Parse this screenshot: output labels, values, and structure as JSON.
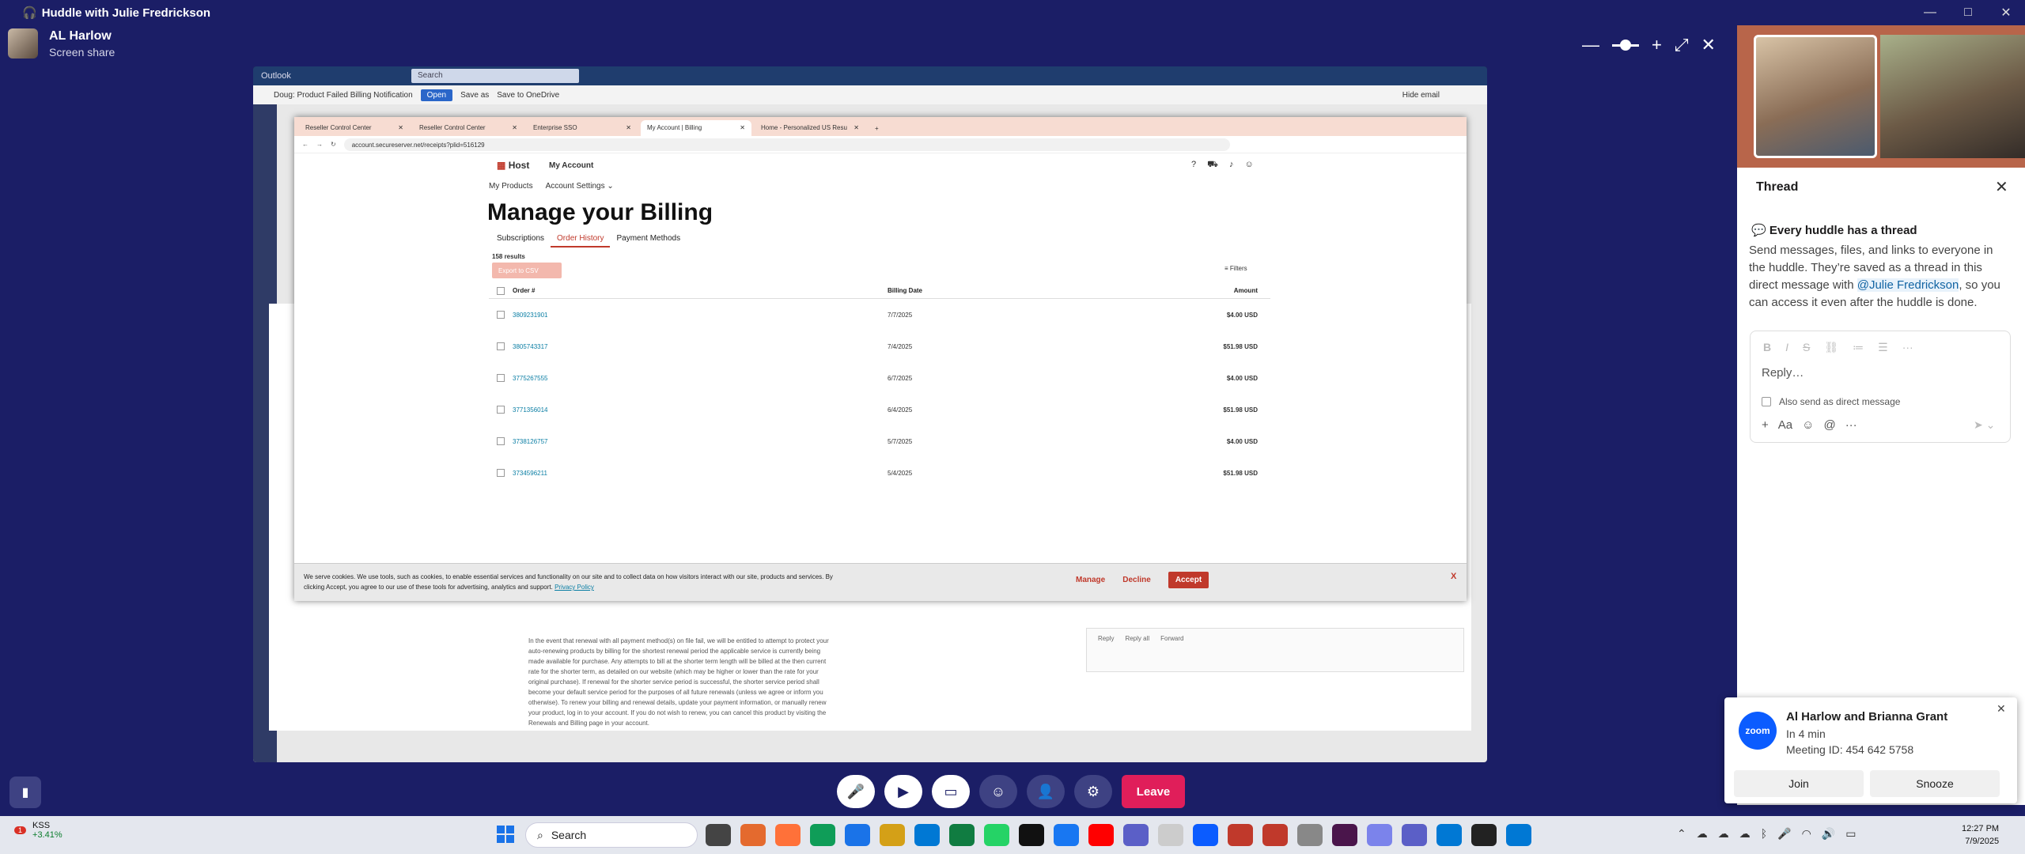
{
  "window": {
    "title": "Huddle with Julie Fredrickson",
    "controls": [
      "—",
      "□",
      "✕"
    ]
  },
  "presenter": {
    "name": "AL Harlow",
    "status": "Screen share"
  },
  "zoom_controls": {
    "minus": "—",
    "plus": "+",
    "fit": "⤢",
    "close": "✕"
  },
  "outlook": {
    "app": "Outlook",
    "search": "Search",
    "subject": "Doug: Product Failed Billing Notification",
    "open": "Open",
    "save_as": "Save as",
    "save_onedrive": "Save to OneDrive",
    "hide_email": "Hide email",
    "mail_text": "In the event that renewal with all payment method(s) on file fail, we will be entitled to attempt to protect your auto-renewing products by billing for the shortest renewal period the applicable service is currently being made available for purchase. Any attempts to bill at the shorter term length will be billed at the then current rate for the shorter term, as detailed on our website (which may be higher or lower than the rate for your original purchase). If renewal for the shorter service period is successful, the shorter service period shall become your default service period for the purposes of all future renewals (unless we agree or inform you otherwise). To renew your billing and renewal details, update your payment information, or manually renew your product, log in to your account. If you do not wish to renew, you can cancel this product by visiting the Renewals and Billing page in your account.",
    "reply_actions": [
      "Reply",
      "Reply all",
      "Forward"
    ]
  },
  "browser": {
    "tabs": [
      {
        "label": "Reseller Control Center"
      },
      {
        "label": "Reseller Control Center"
      },
      {
        "label": "Enterprise SSO"
      },
      {
        "label": "My Account | Billing"
      },
      {
        "label": "Home - Personalized US Resu"
      }
    ],
    "url": "account.secureserver.net/receipts?plid=516129"
  },
  "site": {
    "logo": "Host",
    "my_account": "My Account",
    "nav": [
      "My Products",
      "Account Settings ⌄"
    ],
    "heading": "Manage your Billing",
    "tabs": [
      "Subscriptions",
      "Order History",
      "Payment Methods"
    ],
    "results": "158 results",
    "export": "Export to CSV",
    "filters": "Filters",
    "columns": [
      "Order #",
      "Billing Date",
      "Amount"
    ],
    "rows": [
      {
        "order": "3809231901",
        "date": "7/7/2025",
        "amount": "$4.00 USD"
      },
      {
        "order": "3805743317",
        "date": "7/4/2025",
        "amount": "$51.98 USD"
      },
      {
        "order": "3775267555",
        "date": "6/7/2025",
        "amount": "$4.00 USD"
      },
      {
        "order": "3771356014",
        "date": "6/4/2025",
        "amount": "$51.98 USD"
      },
      {
        "order": "3738126757",
        "date": "5/7/2025",
        "amount": "$4.00 USD"
      },
      {
        "order": "3734596211",
        "date": "5/4/2025",
        "amount": "$51.98 USD"
      }
    ],
    "cookie": {
      "text": "We serve cookies. We use tools, such as cookies, to enable essential services and functionality on our site and to collect data on how visitors interact with our site, products and services. By clicking Accept, you agree to our use of these tools for advertising, analytics and support.",
      "privacy": "Privacy Policy",
      "manage": "Manage",
      "decline": "Decline",
      "accept": "Accept",
      "close": "X"
    }
  },
  "thread": {
    "title": "Thread",
    "heading": "Every huddle has a thread",
    "body_pre": "Send messages, files, and links to everyone in the huddle. They’re saved as a thread in this direct message with",
    "mention": "@Julie Fredrickson",
    "body_post": ", so you can access it even after the huddle is done.",
    "reply_placeholder": "Reply…",
    "also_send": "Also send as direct message"
  },
  "zoom_toast": {
    "logo": "zoom",
    "title": "Al Harlow and Brianna Grant",
    "when": "In 4 min",
    "meeting_id": "Meeting ID: 454 642 5758",
    "join": "Join",
    "snooze": "Snooze"
  },
  "huddle": {
    "leave": "Leave"
  },
  "taskbar": {
    "stock_badge": "1",
    "stock_name": "KSS",
    "stock_change": "+3.41%",
    "search": "Search",
    "time": "12:27 PM",
    "date": "7/9/2025"
  },
  "colors": {
    "slack_purple": "#1b1e66",
    "accent_red": "#c0392b",
    "leave_red": "#e01e5a",
    "zoom_blue": "#0b5cff"
  }
}
